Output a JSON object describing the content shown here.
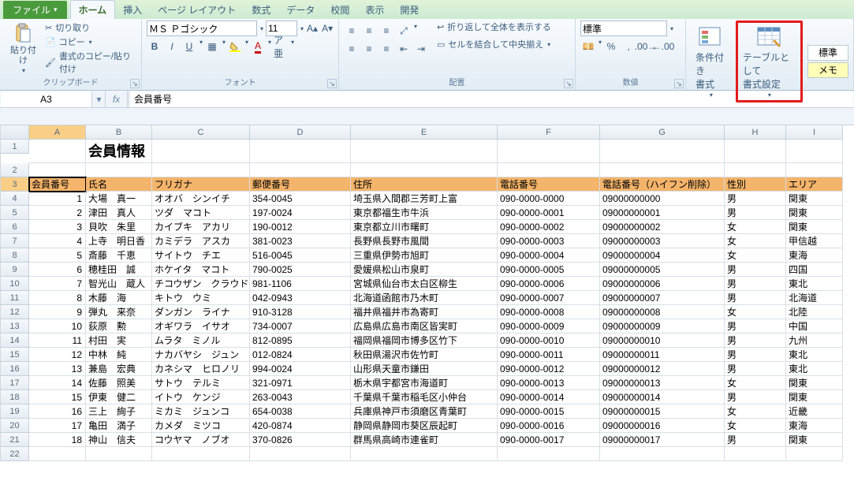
{
  "tabs": {
    "file": "ファイル",
    "items": [
      "ホーム",
      "挿入",
      "ページ レイアウト",
      "数式",
      "データ",
      "校閲",
      "表示",
      "開発"
    ],
    "active": 0
  },
  "clipboard": {
    "paste": "貼り付け",
    "cut": "切り取り",
    "copy": "コピー",
    "brush": "書式のコピー/貼り付け",
    "group": "クリップボード"
  },
  "font": {
    "name": "ＭＳ Ｐゴシック",
    "size": "11",
    "group": "フォント"
  },
  "align": {
    "wrap": "折り返して全体を表示する",
    "merge": "セルを結合して中央揃え",
    "group": "配置"
  },
  "number": {
    "format": "標準",
    "group": "数値"
  },
  "styles": {
    "cond": "条件付き\n書式",
    "table": "テーブルとして\n書式設定",
    "std": "標準",
    "memo": "メモ"
  },
  "cellref": {
    "name": "A3",
    "formula": "会員番号"
  },
  "cols": [
    "A",
    "B",
    "C",
    "D",
    "E",
    "F",
    "G",
    "H",
    "I"
  ],
  "title": "会員情報",
  "headers": [
    "会員番号",
    "氏名",
    "フリガナ",
    "郵便番号",
    "住所",
    "電話番号",
    "電話番号（ハイフン削除）",
    "性別",
    "エリア"
  ],
  "rows": [
    {
      "n": "1",
      "name": "大場　真一",
      "kana": "オオバ　シンイチ",
      "zip": "354-0045",
      "addr": "埼玉県入間郡三芳町上富",
      "tel": "090-0000-0000",
      "teln": "09000000000",
      "sex": "男",
      "area": "関東"
    },
    {
      "n": "2",
      "name": "津田　真人",
      "kana": "ツダ　マコト",
      "zip": "197-0024",
      "addr": "東京都福生市牛浜",
      "tel": "090-0000-0001",
      "teln": "09000000001",
      "sex": "男",
      "area": "関東"
    },
    {
      "n": "3",
      "name": "貝吹　朱里",
      "kana": "カイブキ　アカリ",
      "zip": "190-0012",
      "addr": "東京都立川市曙町",
      "tel": "090-0000-0002",
      "teln": "09000000002",
      "sex": "女",
      "area": "関東"
    },
    {
      "n": "4",
      "name": "上寺　明日香",
      "kana": "カミデラ　アスカ",
      "zip": "381-0023",
      "addr": "長野県長野市風間",
      "tel": "090-0000-0003",
      "teln": "09000000003",
      "sex": "女",
      "area": "甲信越"
    },
    {
      "n": "5",
      "name": "斎藤　千恵",
      "kana": "サイトウ　チエ",
      "zip": "516-0045",
      "addr": "三重県伊勢市旭町",
      "tel": "090-0000-0004",
      "teln": "09000000004",
      "sex": "女",
      "area": "東海"
    },
    {
      "n": "6",
      "name": "穂桂田　誠",
      "kana": "ホケイタ　マコト",
      "zip": "790-0025",
      "addr": "愛媛県松山市泉町",
      "tel": "090-0000-0005",
      "teln": "09000000005",
      "sex": "男",
      "area": "四国"
    },
    {
      "n": "7",
      "name": "智光山　蔵人",
      "kana": "チコウザン　クラウド",
      "zip": "981-1106",
      "addr": "宮城県仙台市太白区柳生",
      "tel": "090-0000-0006",
      "teln": "09000000006",
      "sex": "男",
      "area": "東北"
    },
    {
      "n": "8",
      "name": "木藤　海",
      "kana": "キトウ　ウミ",
      "zip": "042-0943",
      "addr": "北海道函館市乃木町",
      "tel": "090-0000-0007",
      "teln": "09000000007",
      "sex": "男",
      "area": "北海道"
    },
    {
      "n": "9",
      "name": "弾丸　来奈",
      "kana": "ダンガン　ライナ",
      "zip": "910-3128",
      "addr": "福井県福井市為寄町",
      "tel": "090-0000-0008",
      "teln": "09000000008",
      "sex": "女",
      "area": "北陸"
    },
    {
      "n": "10",
      "name": "荻原　勲",
      "kana": "オギワラ　イサオ",
      "zip": "734-0007",
      "addr": "広島県広島市南区皆実町",
      "tel": "090-0000-0009",
      "teln": "09000000009",
      "sex": "男",
      "area": "中国"
    },
    {
      "n": "11",
      "name": "村田　実",
      "kana": "ムラタ　ミノル",
      "zip": "812-0895",
      "addr": "福岡県福岡市博多区竹下",
      "tel": "090-0000-0010",
      "teln": "09000000010",
      "sex": "男",
      "area": "九州"
    },
    {
      "n": "12",
      "name": "中林　純",
      "kana": "ナカバヤシ　ジュン",
      "zip": "012-0824",
      "addr": "秋田県湯沢市佐竹町",
      "tel": "090-0000-0011",
      "teln": "09000000011",
      "sex": "男",
      "area": "東北"
    },
    {
      "n": "13",
      "name": "兼島　宏典",
      "kana": "カネシマ　ヒロノリ",
      "zip": "994-0024",
      "addr": "山形県天童市鎌田",
      "tel": "090-0000-0012",
      "teln": "09000000012",
      "sex": "男",
      "area": "東北"
    },
    {
      "n": "14",
      "name": "佐藤　照美",
      "kana": "サトウ　テルミ",
      "zip": "321-0971",
      "addr": "栃木県宇都宮市海道町",
      "tel": "090-0000-0013",
      "teln": "09000000013",
      "sex": "女",
      "area": "関東"
    },
    {
      "n": "15",
      "name": "伊東　健二",
      "kana": "イトウ　ケンジ",
      "zip": "263-0043",
      "addr": "千葉県千葉市稲毛区小仲台",
      "tel": "090-0000-0014",
      "teln": "09000000014",
      "sex": "男",
      "area": "関東"
    },
    {
      "n": "16",
      "name": "三上　絢子",
      "kana": "ミカミ　ジュンコ",
      "zip": "654-0038",
      "addr": "兵庫県神戸市須磨区青葉町",
      "tel": "090-0000-0015",
      "teln": "09000000015",
      "sex": "女",
      "area": "近畿"
    },
    {
      "n": "17",
      "name": "亀田　満子",
      "kana": "カメダ　ミツコ",
      "zip": "420-0874",
      "addr": "静岡県静岡市葵区辰起町",
      "tel": "090-0000-0016",
      "teln": "09000000016",
      "sex": "女",
      "area": "東海"
    },
    {
      "n": "18",
      "name": "神山　信夫",
      "kana": "コウヤマ　ノブオ",
      "zip": "370-0826",
      "addr": "群馬県高崎市連雀町",
      "tel": "090-0000-0017",
      "teln": "09000000017",
      "sex": "男",
      "area": "関東"
    }
  ]
}
